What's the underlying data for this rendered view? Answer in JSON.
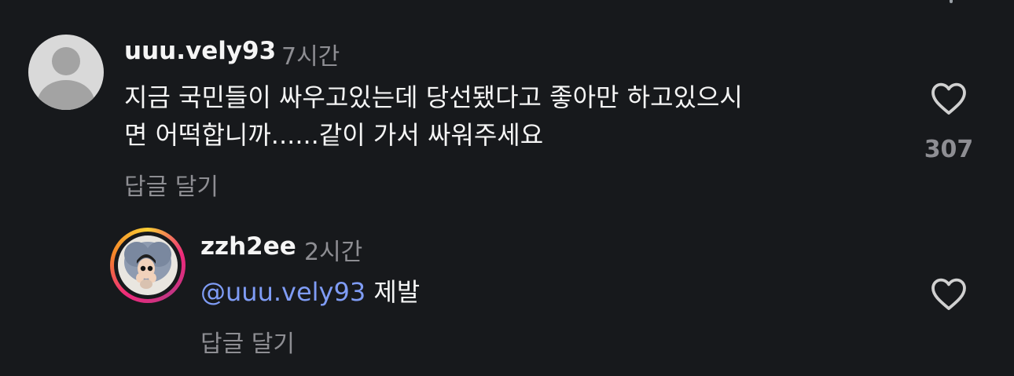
{
  "comments": [
    {
      "username": "uuu.vely93",
      "time": "7시간",
      "text_line1": "지금 국민들이 싸우고있는데 당선됐다고 좋아만 하고있으시",
      "text_line2": "면 어떡합니까......같이 가서 싸워주세요",
      "reply_label": "답글 달기",
      "likes": "307",
      "avatar": "default-user-avatar-icon"
    }
  ],
  "replies": [
    {
      "username": "zzh2ee",
      "time": "2시간",
      "mention": "@uuu.vely93",
      "text": "제발",
      "reply_label": "답글 달기",
      "avatar": "story-ring-avatar"
    }
  ],
  "colors": {
    "background": "#17191c",
    "text": "#f5f5f5",
    "muted": "#8e8e93",
    "mention": "#7f9cf5"
  }
}
